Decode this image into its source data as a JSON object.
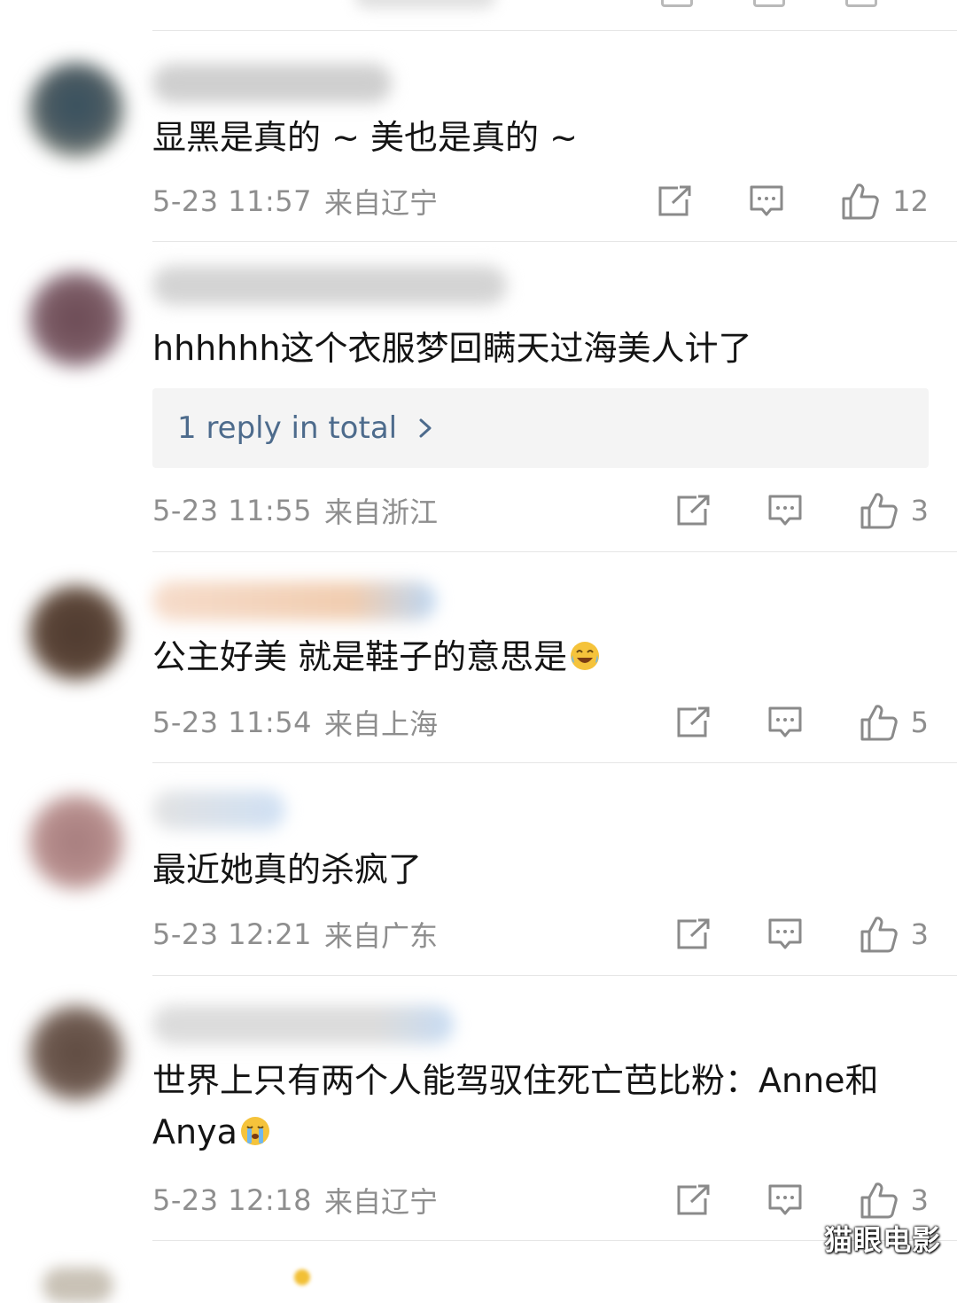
{
  "comments": [
    {
      "text": "显黑是真的 ~ 美也是真的 ~",
      "time": "5-23 11:57",
      "location": "来自辽宁",
      "likes": "12",
      "avatar_color": "#4b5a62",
      "name_color": "#cfcfcf"
    },
    {
      "text": "hhhhhh这个衣服梦回瞒天过海美人计了",
      "reply_label": "1 reply in total",
      "time": "5-23 11:55",
      "location": "来自浙江",
      "likes": "3",
      "avatar_color": "#7a5a63",
      "name_color": "#d4d4d4"
    },
    {
      "text": "公主好美 就是鞋子的意思是",
      "time": "5-23 11:54",
      "location": "来自上海",
      "likes": "5",
      "avatar_color": "#5b4538",
      "name_color": "#f1cdb0",
      "emoji": "laughing-tears-emoji"
    },
    {
      "text": "最近她真的杀疯了",
      "time": "5-23 12:21",
      "location": "来自广东",
      "likes": "3",
      "avatar_color": "#b68d8c",
      "name_color": "#cfe0f4"
    },
    {
      "text": "世界上只有两个人能驾驭住死亡芭比粉：Anne和\nAnya",
      "time": "5-23 12:18",
      "location": "来自辽宁",
      "likes": "3",
      "avatar_color": "#6e5a50",
      "name_color": "#dcdcdc",
      "emoji": "crying-emoji"
    }
  ],
  "watermark": "猫眼电影",
  "colors": {
    "meta_gray": "#8e8e8e",
    "reply_blue": "#4d6b8c",
    "reply_bg": "#f4f4f4",
    "icon_gray": "#8a8a8a"
  }
}
